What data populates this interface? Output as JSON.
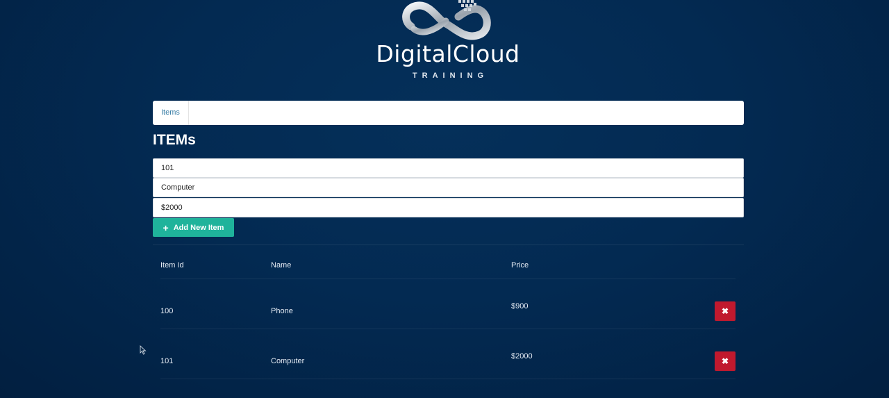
{
  "logo": {
    "name": "DigitalCloud",
    "subtitle": "TRAINING"
  },
  "breadcrumb": {
    "items": [
      {
        "label": "Items"
      }
    ]
  },
  "page": {
    "title": "ITEMs"
  },
  "form": {
    "id_value": "101",
    "name_value": "Computer",
    "price_value": "$2000",
    "add_button_label": "Add New Item"
  },
  "table": {
    "headers": [
      "Item Id",
      "Name",
      "Price"
    ],
    "rows": [
      {
        "id": "100",
        "name": "Phone",
        "price": "$900"
      },
      {
        "id": "101",
        "name": "Computer",
        "price": "$2000"
      }
    ],
    "delete_symbol": "✖"
  },
  "icons": {
    "add": "plus-icon",
    "delete": "close-icon",
    "cursor": "mouse-pointer-icon"
  },
  "colors": {
    "background": "#032a52",
    "accent": "#1fb39b",
    "danger": "#c0192e",
    "link": "#3a7ea6"
  }
}
